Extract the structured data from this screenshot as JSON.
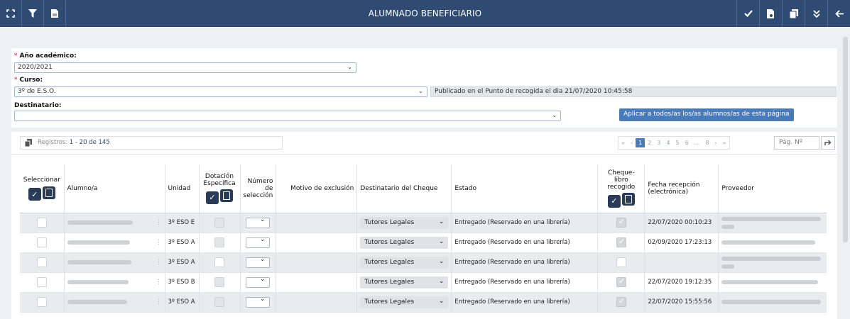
{
  "topbar": {
    "title": "ALUMNADO BENEFICIARIO",
    "left_icons": [
      "expand-icon",
      "filter-icon",
      "pdf-icon"
    ],
    "right_icons": [
      "check-icon",
      "document-icon",
      "copy-icon",
      "double-chevron-down-icon",
      "back-arrow-icon"
    ]
  },
  "filters": {
    "year_label": "Año académico:",
    "year_value": "2020/2021",
    "course_label": "Curso:",
    "course_value": "3º de E.S.O.",
    "published_info": "Publicado en el Punto de recogida el dia 21/07/2020 10:45:58",
    "recipient_label": "Destinatario:",
    "recipient_value": "",
    "apply_button": "Aplicar a todos/as los/as alumnos/as de esta página"
  },
  "pager": {
    "records": "Registros: ",
    "records_range": "1 - 20 de 145",
    "first": "«",
    "prev": "‹",
    "pages": [
      "1",
      "2",
      "3",
      "4",
      "5",
      "6",
      "...",
      "8"
    ],
    "next": "›",
    "last": "»",
    "page_input_placeholder": "Pág. Nº"
  },
  "table": {
    "headers": {
      "select": "Seleccionar",
      "student": "Alumno/a",
      "unit": "Unidad",
      "allocation": "Dotación Específica",
      "number": "Número de selección",
      "exclusion": "Motivo de exclusión",
      "recipient": "Destinatario del Cheque",
      "status": "Estado",
      "collected": "Cheque-libro recogido",
      "received": "Fecha recepción (electrónica)",
      "provider": "Proveedor"
    },
    "rows": [
      {
        "unit": "3º ESO E",
        "recipient": "Tutores Legales",
        "status": "Entregado (Reservado en una librería)",
        "collected": true,
        "date": "22/07/2020 00:10:23"
      },
      {
        "unit": "3º ESO A",
        "recipient": "Tutores Legales",
        "status": "Entregado (Reservado en una librería)",
        "collected": true,
        "date": "02/09/2020 17:23:13"
      },
      {
        "unit": "3º ESO A",
        "recipient": "Tutores Legales",
        "status": "Entregado (Reservado en una librería)",
        "collected": false,
        "date": ""
      },
      {
        "unit": "3º ESO B",
        "recipient": "Tutores Legales",
        "status": "Entregado (Reservado en una librería)",
        "collected": true,
        "date": "22/07/2020 19:12:35"
      },
      {
        "unit": "3º ESO A",
        "recipient": "Tutores Legales",
        "status": "Entregado (Reservado en una librería)",
        "collected": true,
        "date": "22/07/2020 15:55:56"
      }
    ]
  }
}
